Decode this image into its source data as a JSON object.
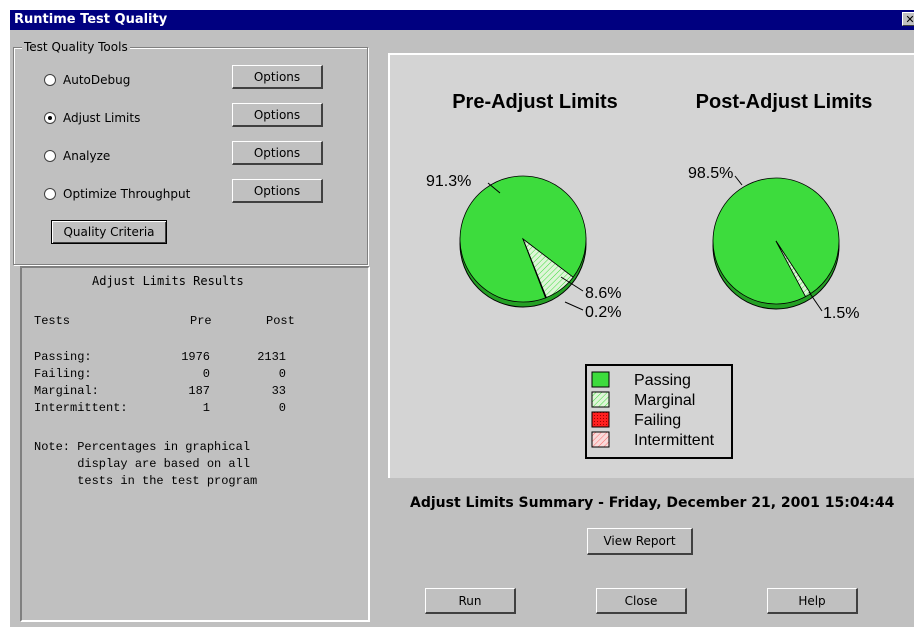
{
  "window": {
    "title": "Runtime Test Quality",
    "close_glyph": "✕"
  },
  "tools": {
    "group_label": "Test Quality Tools",
    "options": [
      {
        "label": "AutoDebug",
        "selected": false,
        "button": "Options"
      },
      {
        "label": "Adjust Limits",
        "selected": true,
        "button": "Options"
      },
      {
        "label": "Analyze",
        "selected": false,
        "button": "Options"
      },
      {
        "label": "Optimize Throughput",
        "selected": false,
        "button": "Options"
      }
    ],
    "quality_criteria": "Quality Criteria"
  },
  "results": {
    "title": "Adjust Limits Results",
    "header": {
      "col1": "Tests",
      "col2": "Pre",
      "col3": "Post"
    },
    "rows": [
      {
        "name": "Passing:",
        "pre": "1976",
        "post": "2131"
      },
      {
        "name": "Failing:",
        "pre": "0",
        "post": "0"
      },
      {
        "name": "Marginal:",
        "pre": "187",
        "post": "33"
      },
      {
        "name": "Intermittent:",
        "pre": "1",
        "post": "0"
      }
    ],
    "note_lines": [
      "Note: Percentages in graphical",
      "      display are based on all",
      "      tests in the test program"
    ]
  },
  "charts": {
    "colors": {
      "passing": "#3ddc3d",
      "marginal": "#d8f0d0",
      "failing": "#ff2020",
      "intermittent": "#f4c8c8"
    },
    "pre": {
      "title": "Pre-Adjust Limits",
      "labels": {
        "passing": "91.3%",
        "marginal": "8.6%",
        "intermittent": "0.2%"
      }
    },
    "post": {
      "title": "Post-Adjust Limits",
      "labels": {
        "passing": "98.5%",
        "marginal": "1.5%"
      }
    },
    "legend": [
      "Passing",
      "Marginal",
      "Failing",
      "Intermittent"
    ]
  },
  "chart_data": [
    {
      "type": "pie",
      "title": "Pre-Adjust Limits",
      "categories": [
        "Passing",
        "Marginal",
        "Failing",
        "Intermittent"
      ],
      "values": [
        91.3,
        8.6,
        0,
        0.2
      ]
    },
    {
      "type": "pie",
      "title": "Post-Adjust Limits",
      "categories": [
        "Passing",
        "Marginal",
        "Failing",
        "Intermittent"
      ],
      "values": [
        98.5,
        1.5,
        0,
        0
      ]
    }
  ],
  "summary": "Adjust Limits Summary - Friday, December 21, 2001 15:04:44",
  "buttons": {
    "view_report": "View Report",
    "run": "Run",
    "close": "Close",
    "help": "Help"
  }
}
